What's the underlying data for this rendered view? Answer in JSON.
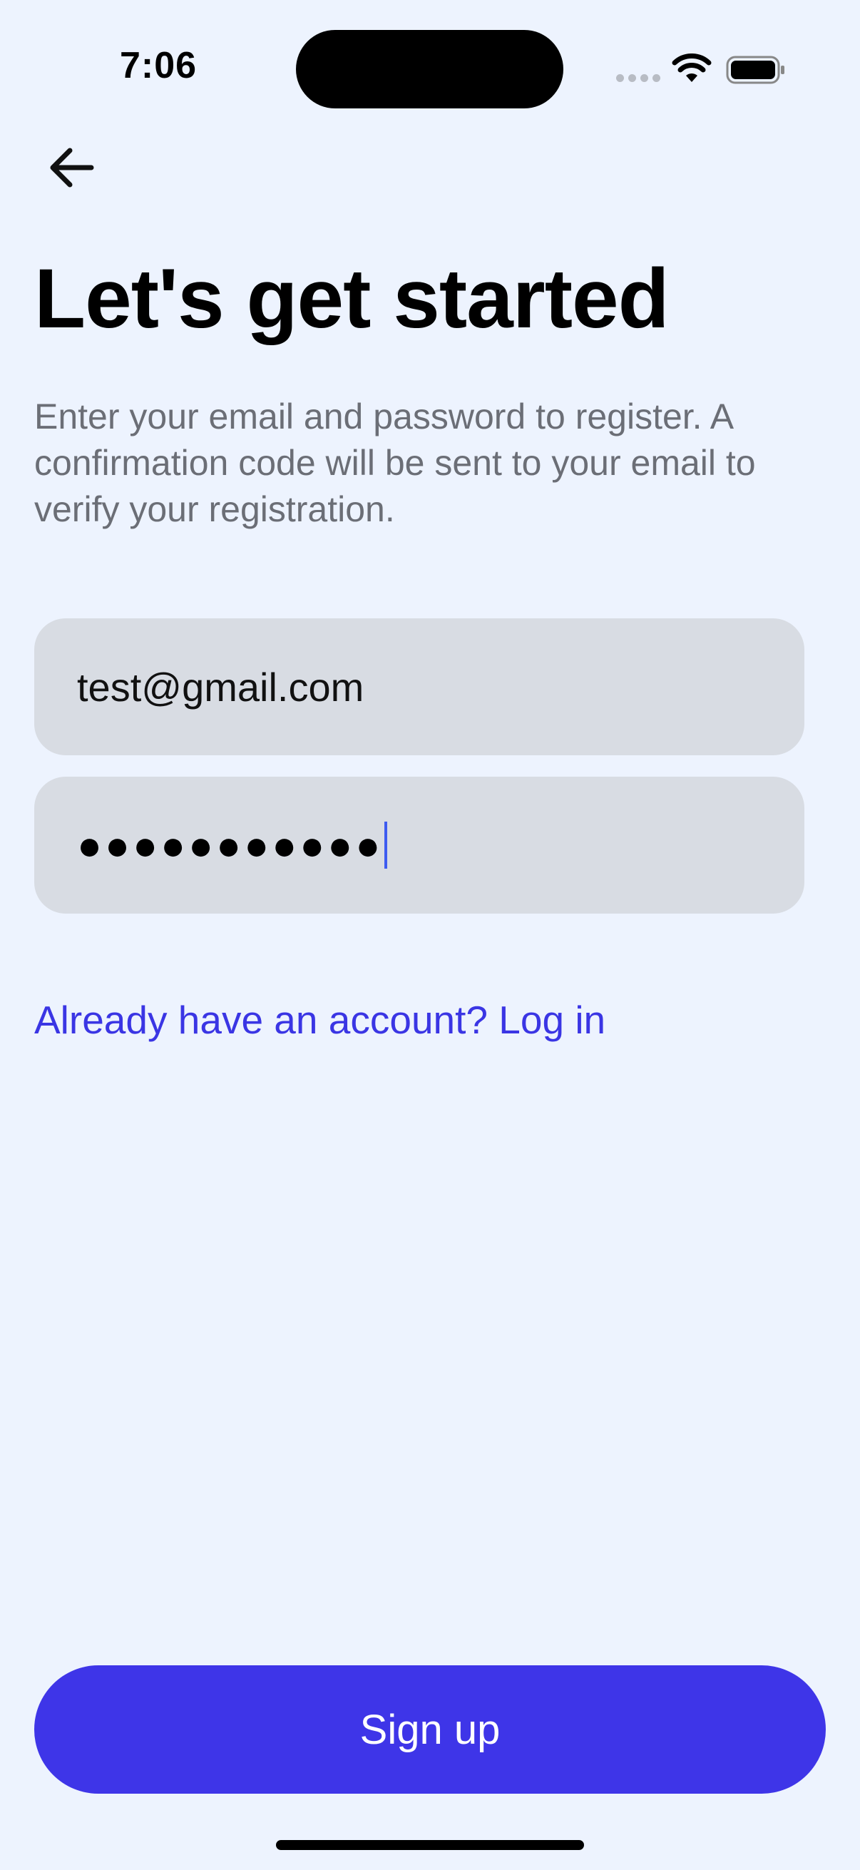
{
  "status_bar": {
    "time": "7:06",
    "wifi_icon": "wifi-icon",
    "battery_icon": "battery-icon"
  },
  "header": {
    "back_icon": "arrow-left-icon"
  },
  "main": {
    "title": "Let's get started",
    "subtitle": "Enter your email and password to register. A confirmation code will be sent to your email to verify your registration.",
    "email_value": "test@gmail.com",
    "password_masked": "●●●●●●●●●●●",
    "login_link": "Already have an account? Log in"
  },
  "footer": {
    "signup_label": "Sign up"
  },
  "colors": {
    "background": "#EDF3FE",
    "accent": "#3E35E8",
    "link": "#3A35E4",
    "field_bg": "#D8DCE3"
  }
}
